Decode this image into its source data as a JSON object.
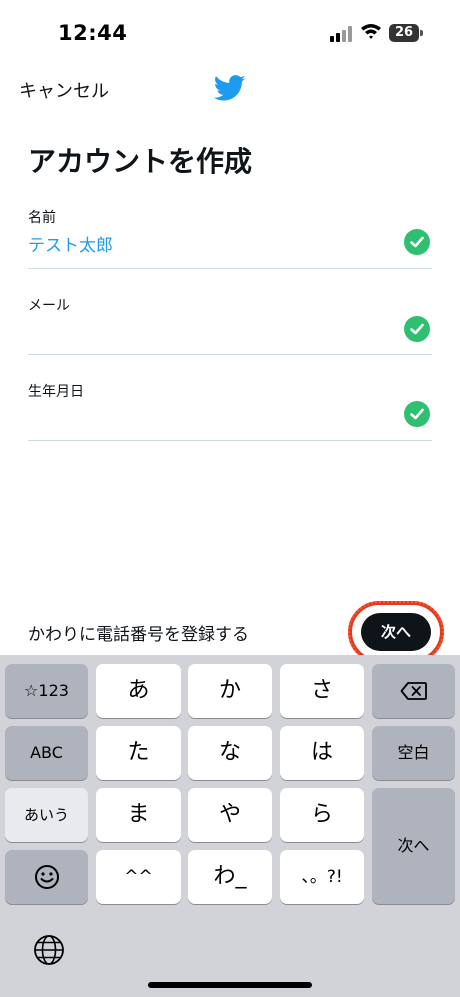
{
  "status_bar": {
    "time": "12:44",
    "battery": "26"
  },
  "header": {
    "cancel_label": "キャンセル",
    "logo_icon": "twitter-bird-icon"
  },
  "form": {
    "title": "アカウントを作成",
    "fields": [
      {
        "label": "名前",
        "value": "テスト太郎",
        "valid": true
      },
      {
        "label": "メール",
        "value": "",
        "valid": true
      },
      {
        "label": "生年月日",
        "value": "",
        "valid": true
      }
    ]
  },
  "footer": {
    "alt_link": "かわりに電話番号を登録する",
    "next_label": "次へ"
  },
  "keyboard": {
    "left": [
      "☆123",
      "ABC",
      "あいう"
    ],
    "rows": [
      [
        "あ",
        "か",
        "さ"
      ],
      [
        "た",
        "な",
        "は"
      ],
      [
        "ま",
        "や",
        "ら"
      ],
      [
        "^^",
        "わ_",
        "、。?!"
      ]
    ],
    "space_label": "空白",
    "return_label": "次へ"
  },
  "colors": {
    "accent": "#1d9bf0",
    "check": "#2fbf71",
    "highlight": "#e23a1e"
  }
}
